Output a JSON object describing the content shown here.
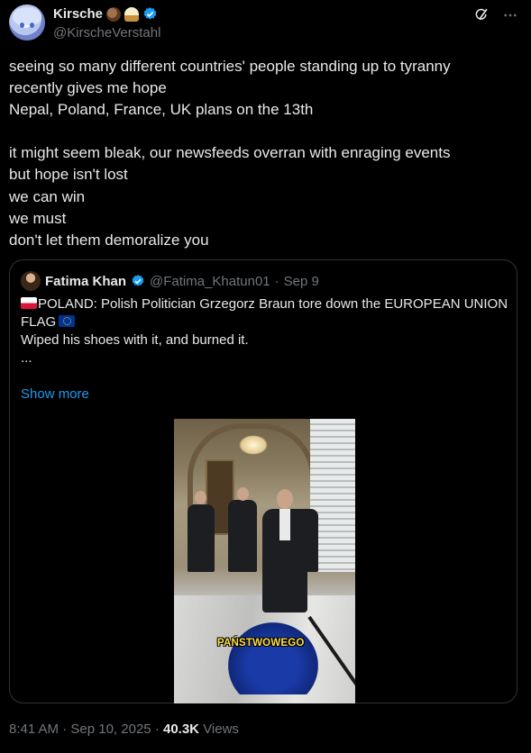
{
  "author": {
    "display_name": "Kirsche",
    "name_emoji": [
      "coconut-emoji",
      "cupcake-emoji"
    ],
    "verified_icon": "verified-badge-icon",
    "handle": "@KirscheVerstahl"
  },
  "header_icons": [
    "grok-icon",
    "more-icon"
  ],
  "post": {
    "text": "seeing so many different countries' people standing up to tyranny\nrecently gives me hope\nNepal, Poland, France, UK plans on the 13th\n\nit might seem bleak, our newsfeeds overran with enraging events\nbut hope isn't lost\nwe can win\nwe must\ndon't let them demoralize you"
  },
  "quote": {
    "display_name": "Fatima Khan",
    "handle": "@Fatima_Khatun01",
    "separator": "·",
    "date": "Sep 9",
    "text_line1": "POLAND: Polish Politician Grzegorz Braun tore down the EUROPEAN UNION FLAG",
    "text_line2": "\nWiped his shoes with it, and burned it.\n...",
    "show_more": "Show more",
    "media": {
      "caption": "PAŃSTWOWEGO"
    }
  },
  "footer": {
    "time": "8:41 AM",
    "dot1": "·",
    "date": "Sep 10, 2025",
    "dot2": "·",
    "views_count": "40.3K",
    "views_label": "Views"
  },
  "colors": {
    "background": "#000000",
    "text": "#e7e9ea",
    "muted": "#71767b",
    "link": "#1d9bf0",
    "border": "#2f3336",
    "verified": "#1d9bf0"
  }
}
